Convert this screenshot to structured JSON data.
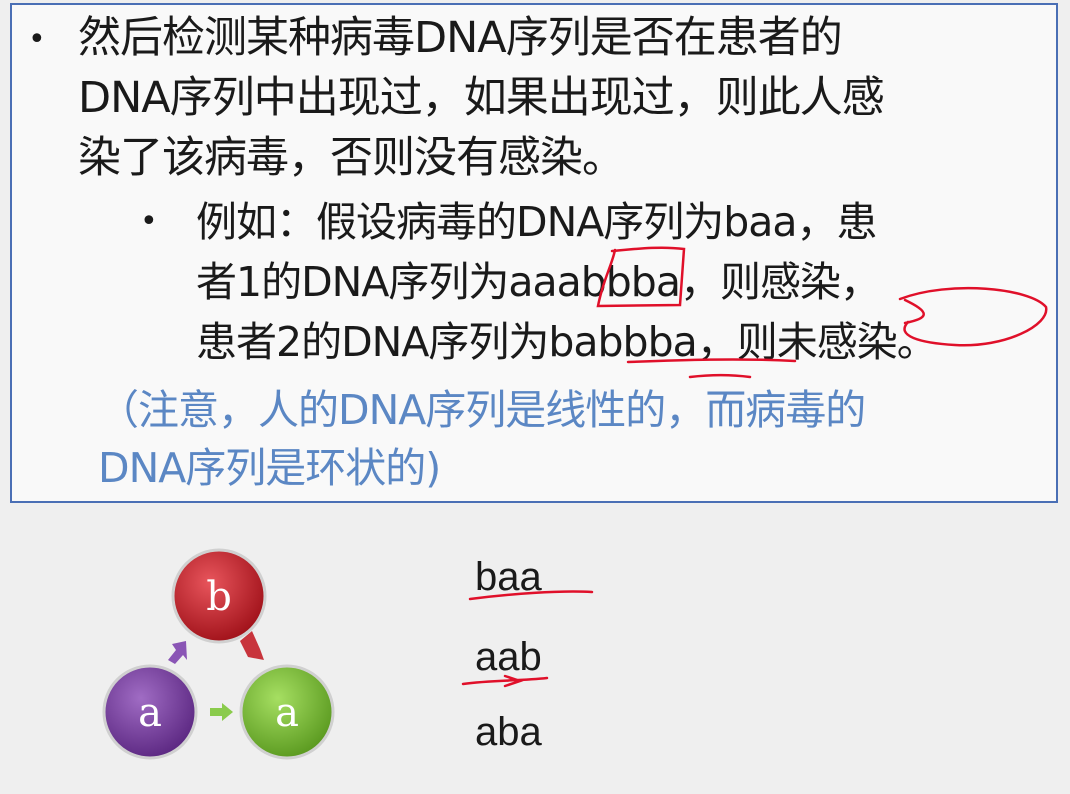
{
  "slide": {
    "bullets": [
      {
        "lines": [
          "然后检测某种病毒DNA序列是否在患者的",
          "DNA序列中出现过，如果出现过，则此人感",
          "染了该病毒，否则没有感染。"
        ],
        "sub": {
          "lines": [
            "例如：假设病毒的DNA序列为baa，患",
            "者1的DNA序列为aaabbba，则感染，",
            "患者2的DNA序列为babbba，则未感染。"
          ]
        }
      }
    ],
    "note_lines": [
      "（注意，人的DNA序列是线性的，而病毒的",
      "DNA序列是环状的)"
    ]
  },
  "diagram": {
    "nodes": [
      {
        "label": "b",
        "color": "#c0262e"
      },
      {
        "label": "a",
        "color": "#7b3fa0"
      },
      {
        "label": "a",
        "color": "#7bbf3a"
      }
    ],
    "sequences": [
      "baa",
      "aab",
      "aba"
    ]
  },
  "colors": {
    "border": "#4a6fb5",
    "note": "#5b87c4",
    "annotation": "#e0102a"
  }
}
